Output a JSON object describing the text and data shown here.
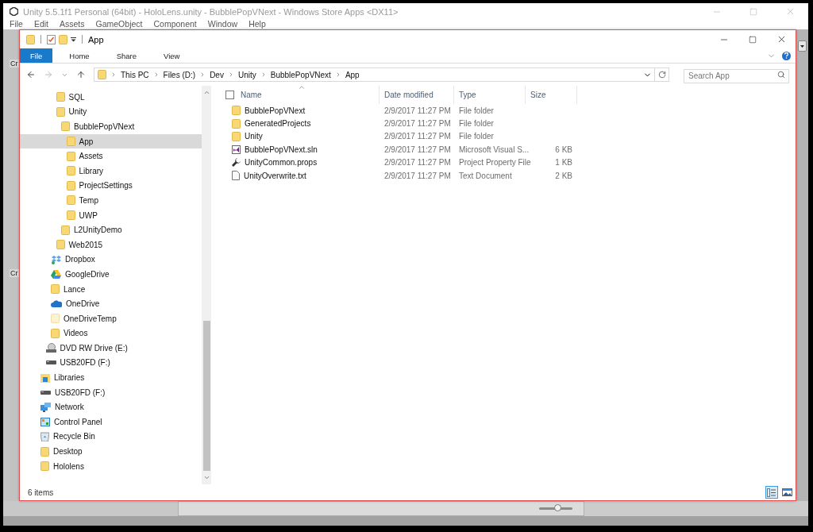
{
  "unity": {
    "title": "Unity 5.5.1f1 Personal (64bit) - HoloLens.unity - BubblePopVNext - Windows Store Apps <DX11>",
    "menu": [
      "File",
      "Edit",
      "Assets",
      "GameObject",
      "Component",
      "Window",
      "Help"
    ],
    "side_labels": [
      "Cr",
      "Cr"
    ],
    "slider": {
      "level": 0.55
    }
  },
  "explorer": {
    "title": "App",
    "ribbon_tabs": [
      {
        "label": "File",
        "selected": true
      },
      {
        "label": "Home",
        "selected": false
      },
      {
        "label": "Share",
        "selected": false
      },
      {
        "label": "View",
        "selected": false
      }
    ],
    "address": {
      "crumbs": [
        "This PC",
        "Files (D:)",
        "Dev",
        "Unity",
        "BubblePopVNext",
        "App"
      ]
    },
    "search": {
      "placeholder": "Search App"
    },
    "nav_tree": [
      {
        "children": [
          {
            "children": [
              {
                "children": [
                  {
                    "label": "SQL",
                    "kind": "folder",
                    "selected": false
                  },
                  {
                    "label": "Unity",
                    "kind": "folder",
                    "selected": false,
                    "children": [
                      {
                        "label": "BubblePopVNext",
                        "kind": "folder",
                        "selected": false,
                        "children": [
                          {
                            "label": "App",
                            "kind": "folder",
                            "selected": true
                          },
                          {
                            "label": "Assets",
                            "kind": "folder",
                            "selected": false
                          },
                          {
                            "label": "Library",
                            "kind": "folder",
                            "selected": false
                          },
                          {
                            "label": "ProjectSettings",
                            "kind": "folder",
                            "selected": false
                          },
                          {
                            "label": "Temp",
                            "kind": "folder",
                            "selected": false
                          },
                          {
                            "label": "UWP",
                            "kind": "folder",
                            "selected": false
                          }
                        ]
                      },
                      {
                        "label": "L2UnityDemo",
                        "kind": "folder",
                        "selected": false
                      }
                    ]
                  },
                  {
                    "label": "Web2015",
                    "kind": "folder",
                    "selected": false
                  }
                ]
              },
              {
                "label": "Dropbox",
                "kind": "dropbox",
                "selected": false
              },
              {
                "label": "GoogleDrive",
                "kind": "gdrive",
                "selected": false
              },
              {
                "label": "Lance",
                "kind": "folder",
                "selected": false
              },
              {
                "label": "OneDrive",
                "kind": "onedrive",
                "selected": false
              },
              {
                "label": "OneDriveTemp",
                "kind": "hidden-folder",
                "selected": false
              },
              {
                "label": "Videos",
                "kind": "folder",
                "selected": false
              }
            ]
          },
          {
            "label": "DVD RW Drive (E:)",
            "kind": "dvd",
            "selected": false
          },
          {
            "label": "USB20FD (F:)",
            "kind": "drive",
            "selected": false
          }
        ]
      },
      {
        "label": "Libraries",
        "kind": "libraries",
        "selected": false
      },
      {
        "label": "USB20FD (F:)",
        "kind": "drive",
        "selected": false
      },
      {
        "label": "Network",
        "kind": "network",
        "selected": false
      },
      {
        "label": "Control Panel",
        "kind": "control-panel",
        "selected": false
      },
      {
        "label": "Recycle Bin",
        "kind": "recycle-bin",
        "selected": false
      },
      {
        "label": "Desktop",
        "kind": "folder",
        "selected": false
      },
      {
        "label": "Hololens",
        "kind": "folder",
        "selected": false
      }
    ],
    "select_all": {
      "checked": false
    },
    "columns": [
      "Name",
      "Date modified",
      "Type",
      "Size"
    ],
    "files": [
      {
        "kind": "folder",
        "name": "BubblePopVNext",
        "date": "2/9/2017 11:27 PM",
        "type": "File folder"
      },
      {
        "kind": "folder",
        "name": "GeneratedProjects",
        "date": "2/9/2017 11:27 PM",
        "type": "File folder"
      },
      {
        "kind": "folder",
        "name": "Unity",
        "date": "2/9/2017 11:27 PM",
        "type": "File folder"
      },
      {
        "kind": "solution",
        "name": "BubblePopVNext.sln",
        "date": "2/9/2017 11:27 PM",
        "type": "Microsoft Visual S...",
        "size": "6 KB"
      },
      {
        "kind": "wrench",
        "name": "UnityCommon.props",
        "date": "2/9/2017 11:27 PM",
        "type": "Project Property File",
        "size": "1 KB"
      },
      {
        "kind": "document",
        "name": "UnityOverwrite.txt",
        "date": "2/9/2017 11:27 PM",
        "type": "Text Document",
        "size": "2 KB"
      }
    ],
    "status": "6 items",
    "views": [
      {
        "kind": "details",
        "selected": true
      },
      {
        "kind": "large-icons",
        "selected": false
      }
    ]
  }
}
